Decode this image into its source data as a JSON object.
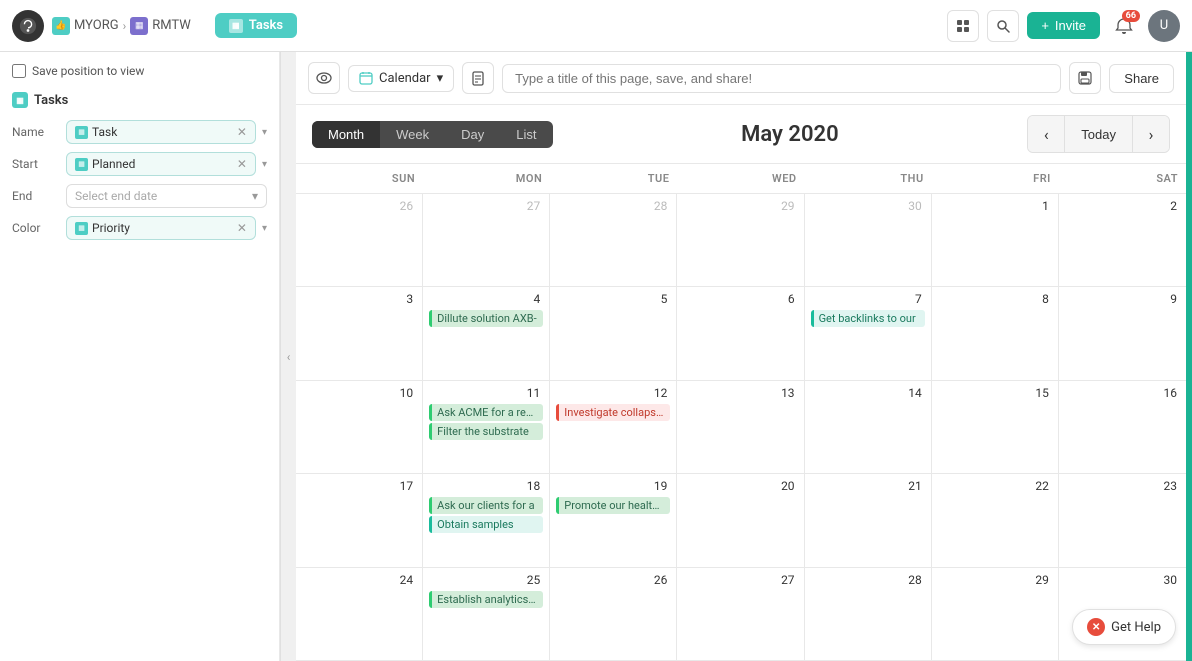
{
  "topnav": {
    "org_label": "MYORG",
    "workspace_label": "RMTW",
    "tasks_label": "Tasks",
    "invite_label": "Invite",
    "notif_count": "66"
  },
  "toolbar": {
    "calendar_label": "Calendar",
    "page_title_placeholder": "Type a title of this page, save, and share!",
    "share_label": "Share"
  },
  "sidebar": {
    "save_position_label": "Save position to view",
    "tasks_section_label": "Tasks",
    "filters": [
      {
        "label": "Name",
        "value": "Task",
        "type": "pill"
      },
      {
        "label": "Start",
        "value": "Planned",
        "type": "pill"
      },
      {
        "label": "End",
        "value": "Select end date",
        "type": "select"
      },
      {
        "label": "Color",
        "value": "Priority",
        "type": "pill"
      }
    ]
  },
  "calendar": {
    "view_tabs": [
      "Month",
      "Week",
      "Day",
      "List"
    ],
    "active_tab": "Month",
    "month_title": "May 2020",
    "nav": {
      "prev": "‹",
      "today": "Today",
      "next": "›"
    },
    "day_names": [
      "SUN",
      "MON",
      "TUE",
      "WED",
      "THU",
      "FRI",
      "SAT"
    ],
    "weeks": [
      [
        {
          "num": "26",
          "muted": true,
          "events": []
        },
        {
          "num": "27",
          "muted": true,
          "events": []
        },
        {
          "num": "28",
          "muted": true,
          "events": []
        },
        {
          "num": "29",
          "muted": true,
          "events": []
        },
        {
          "num": "30",
          "muted": true,
          "events": []
        },
        {
          "num": "1",
          "muted": false,
          "events": []
        },
        {
          "num": "2",
          "muted": false,
          "events": []
        }
      ],
      [
        {
          "num": "3",
          "muted": false,
          "events": []
        },
        {
          "num": "4",
          "muted": false,
          "events": [
            {
              "text": "Dillute solution AXB-",
              "color": "green"
            }
          ]
        },
        {
          "num": "5",
          "muted": false,
          "events": []
        },
        {
          "num": "6",
          "muted": false,
          "events": []
        },
        {
          "num": "7",
          "muted": false,
          "events": [
            {
              "text": "Get backlinks to our",
              "color": "teal"
            }
          ]
        },
        {
          "num": "8",
          "muted": false,
          "events": []
        },
        {
          "num": "9",
          "muted": false,
          "events": []
        }
      ],
      [
        {
          "num": "10",
          "muted": false,
          "events": []
        },
        {
          "num": "11",
          "muted": false,
          "events": [
            {
              "text": "Ask ACME for a revie",
              "color": "green"
            },
            {
              "text": "Filter the substrate",
              "color": "green"
            }
          ]
        },
        {
          "num": "12",
          "muted": false,
          "events": [
            {
              "text": "Investigate collapsed",
              "color": "red"
            }
          ]
        },
        {
          "num": "13",
          "muted": false,
          "events": []
        },
        {
          "num": "14",
          "muted": false,
          "events": []
        },
        {
          "num": "15",
          "muted": false,
          "events": []
        },
        {
          "num": "16",
          "muted": false,
          "events": []
        }
      ],
      [
        {
          "num": "17",
          "muted": false,
          "events": []
        },
        {
          "num": "18",
          "muted": false,
          "events": [
            {
              "text": "Ask our clients for a",
              "color": "green"
            },
            {
              "text": "Obtain samples",
              "color": "teal"
            }
          ]
        },
        {
          "num": "19",
          "muted": false,
          "events": [
            {
              "text": "Promote our health c",
              "color": "green"
            }
          ]
        },
        {
          "num": "20",
          "muted": false,
          "events": []
        },
        {
          "num": "21",
          "muted": false,
          "events": []
        },
        {
          "num": "22",
          "muted": false,
          "events": []
        },
        {
          "num": "23",
          "muted": false,
          "events": []
        }
      ],
      [
        {
          "num": "24",
          "muted": false,
          "events": []
        },
        {
          "num": "25",
          "muted": false,
          "events": [
            {
              "text": "Establish analytics m",
              "color": "green"
            }
          ]
        },
        {
          "num": "26",
          "muted": false,
          "events": []
        },
        {
          "num": "27",
          "muted": false,
          "events": []
        },
        {
          "num": "28",
          "muted": false,
          "events": []
        },
        {
          "num": "29",
          "muted": false,
          "events": []
        },
        {
          "num": "30",
          "muted": false,
          "events": []
        }
      ]
    ]
  },
  "help": {
    "label": "Get Help"
  }
}
